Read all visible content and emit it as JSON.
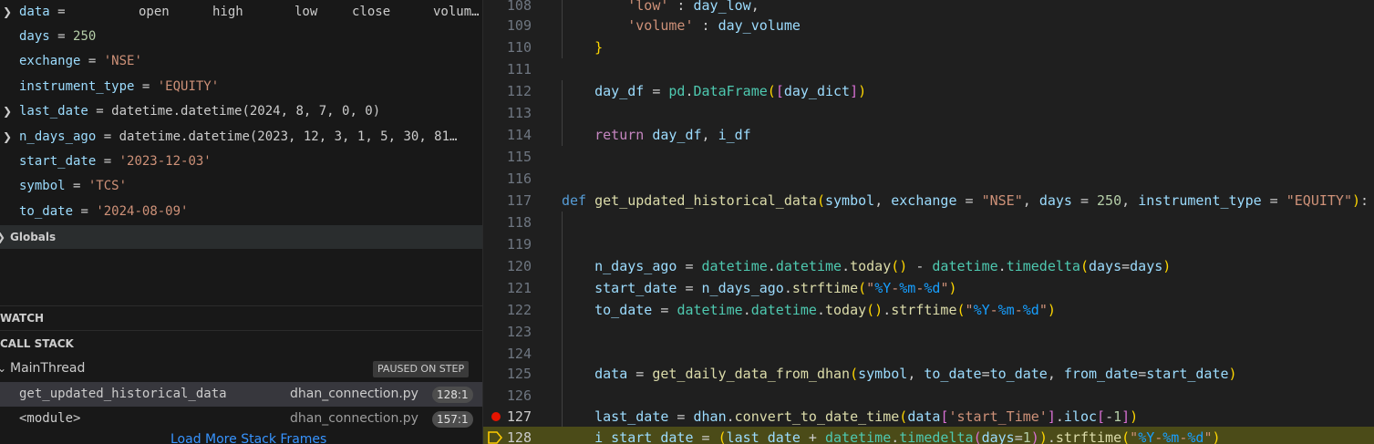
{
  "variables": {
    "data": {
      "name": "data",
      "cols": [
        "open",
        "high",
        "low",
        "close",
        "volum…"
      ]
    },
    "days": {
      "name": "days",
      "value": "250"
    },
    "exchange": {
      "name": "exchange",
      "value": "'NSE'"
    },
    "instrument_type": {
      "name": "instrument_type",
      "value": "'EQUITY'"
    },
    "last_date": {
      "name": "last_date",
      "value": "datetime.datetime(2024, 8, 7, 0, 0)"
    },
    "n_days_ago": {
      "name": "n_days_ago",
      "value": "datetime.datetime(2023, 12, 3, 1, 5, 30, 81…"
    },
    "start_date": {
      "name": "start_date",
      "value": "'2023-12-03'"
    },
    "symbol": {
      "name": "symbol",
      "value": "'TCS'"
    },
    "to_date": {
      "name": "to_date",
      "value": "'2024-08-09'"
    }
  },
  "sections": {
    "globals": "Globals",
    "watch": "WATCH",
    "call_stack": "CALL STACK"
  },
  "call_stack": {
    "thread": "MainThread",
    "status": "PAUSED ON STEP",
    "frames": [
      {
        "fn": "get_updated_historical_data",
        "file": "dhan_connection.py",
        "line": "128:1"
      },
      {
        "fn": "<module>",
        "file": "dhan_connection.py",
        "line": "157:1"
      }
    ],
    "load_more": "Load More Stack Frames"
  },
  "editor": {
    "line_numbers": [
      "108",
      "109",
      "110",
      "111",
      "112",
      "113",
      "114",
      "115",
      "116",
      "117",
      "118",
      "119",
      "120",
      "121",
      "122",
      "123",
      "124",
      "125",
      "126",
      "127",
      "128"
    ]
  },
  "colors": {
    "breakpoint": "#e51400",
    "current_line": "#4b4b18",
    "link": "#3794ff"
  }
}
